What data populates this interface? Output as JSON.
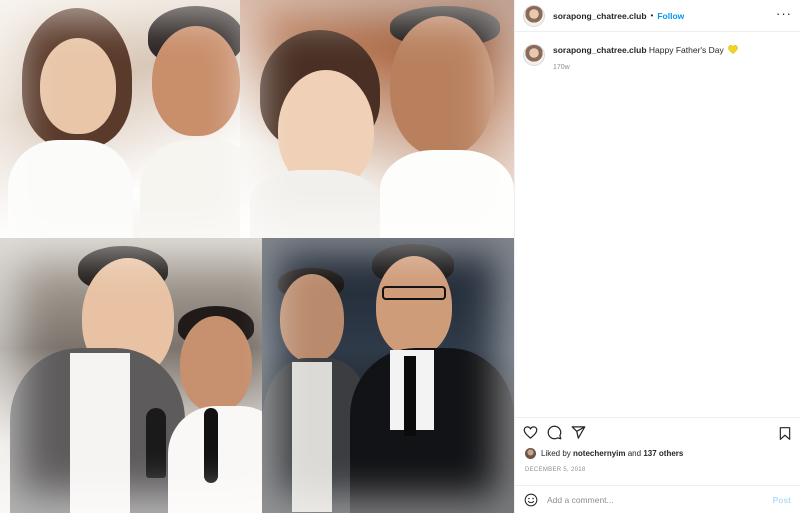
{
  "post": {
    "media_alt": "Collage photo post",
    "header": {
      "username": "sorapong_chatree.club",
      "separator": "•",
      "follow_label": "Follow",
      "more_icon": "more-horizontal-icon"
    },
    "caption": {
      "username": "sorapong_chatree.club",
      "text": "Happy Father's Day",
      "emoji": "yellow-heart-icon",
      "time_ago": "170w"
    },
    "actions": {
      "like_icon": "heart-outline-icon",
      "comment_icon": "comment-icon",
      "share_icon": "share-icon",
      "save_icon": "bookmark-icon"
    },
    "likes": {
      "prefix": "Liked by",
      "user": "notechernyim",
      "conjunction": "and",
      "others": "137 others"
    },
    "date": "DECEMBER 5, 2018",
    "comment": {
      "placeholder": "Add a comment...",
      "post_label": "Post",
      "emoji_icon": "smiley-icon"
    },
    "colors": {
      "accent": "#0095f6",
      "post_disabled": "#b2dffc",
      "heart_emoji": "#f7d41c"
    }
  }
}
